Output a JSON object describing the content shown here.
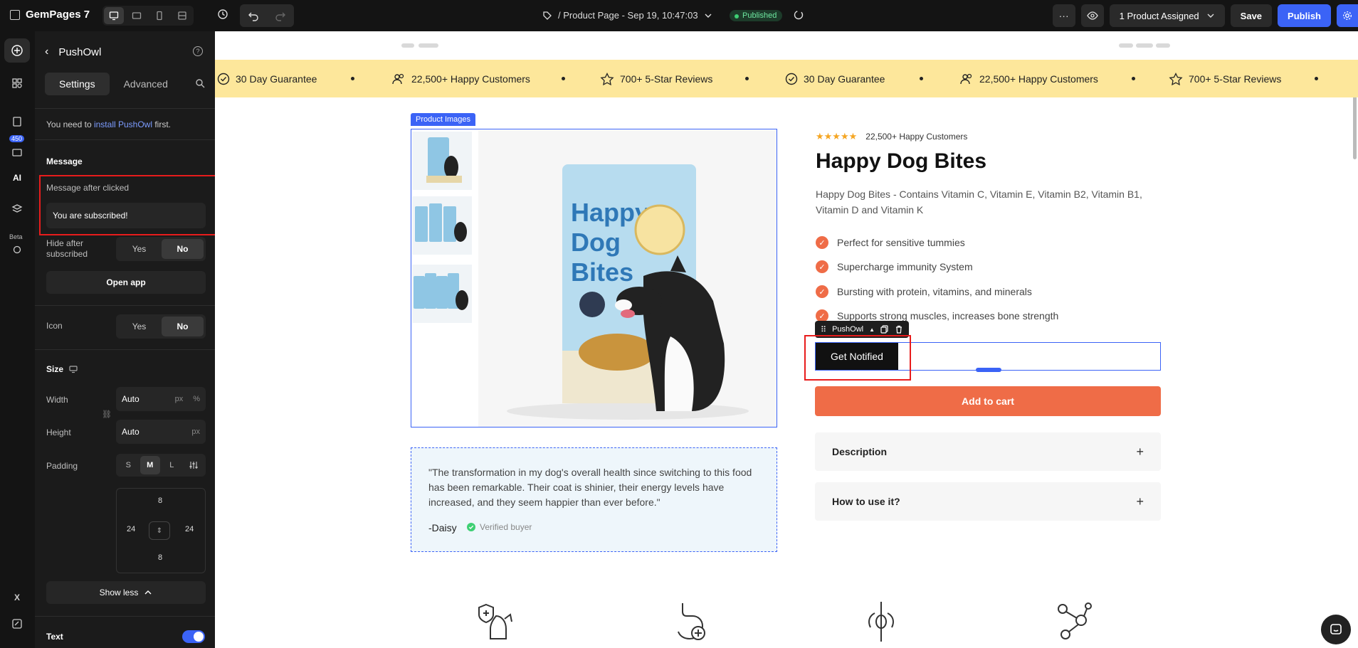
{
  "topbar": {
    "app_name": "GemPages 7",
    "page_title": "/ Product Page - Sep 19, 10:47:03",
    "status": "Published",
    "assigned": "1 Product Assigned",
    "save": "Save",
    "publish": "Publish",
    "more": "···"
  },
  "rail": {
    "badge": "450",
    "ai": "AI",
    "beta": "Beta",
    "x": "X"
  },
  "panel": {
    "title": "PushOwl",
    "help": "?",
    "tabs": [
      "Settings",
      "Advanced"
    ],
    "note_prefix": "You need to ",
    "note_link": "install PushOwl",
    "note_suffix": " first.",
    "message_section": "Message",
    "message_label": "Message after clicked",
    "message_value": "You are subscribed!",
    "hide_label": "Hide after subscribed",
    "yes": "Yes",
    "no": "No",
    "open_app": "Open app",
    "icon_label": "Icon",
    "size_section": "Size",
    "width_label": "Width",
    "width_value": "Auto",
    "height_label": "Height",
    "height_value": "Auto",
    "unit_px": "px",
    "unit_pct": "%",
    "padding_label": "Padding",
    "pad_sizes": [
      "S",
      "M",
      "L"
    ],
    "pad_top": "8",
    "pad_left": "24",
    "pad_right": "24",
    "pad_bottom": "8",
    "show_less": "Show less",
    "text_label": "Text"
  },
  "banner": {
    "items": [
      {
        "text": "30 Day Guarantee",
        "icon": "check-circle-icon"
      },
      {
        "text": "22,500+ Happy Customers",
        "icon": "users-icon"
      },
      {
        "text": "700+ 5-Star Reviews",
        "icon": "star-icon"
      },
      {
        "text": "30 Day Guarantee",
        "icon": "check-circle-icon"
      },
      {
        "text": "22,500+ Happy Customers",
        "icon": "users-icon"
      },
      {
        "text": "700+ 5-Star Reviews",
        "icon": "star-icon"
      }
    ]
  },
  "product": {
    "images_tag": "Product Images",
    "stars": "★★★★★",
    "reviews": "22,500+ Happy Customers",
    "title": "Happy Dog Bites",
    "description": "Happy Dog Bites - Contains Vitamin C, Vitamin E, Vitamin B2, Vitamin B1, Vitamin D and Vitamin K",
    "benefits": [
      "Perfect for sensitive tummies",
      "Supercharge immunity System",
      "Bursting with protein, vitamins, and minerals",
      "Supports strong muscles, increases bone strength"
    ],
    "pushowl_tag": "PushOwl",
    "notify": "Get Notified",
    "add_to_cart": "Add to cart",
    "accordions": [
      "Description",
      "How to use it?"
    ],
    "bag_text": "Happy Dog Bites"
  },
  "testimonial": {
    "quote": "\"The transformation in my dog's overall health since switching to this food has been remarkable. Their coat is shinier, their energy levels have increased, and they seem happier than ever before.\"",
    "author": "-Daisy",
    "verified": "Verified buyer"
  },
  "colors": {
    "accent": "#3b63f6",
    "brand_orange": "#ef6c47",
    "banner": "#fde79b",
    "annotation": "#e81c1c"
  }
}
